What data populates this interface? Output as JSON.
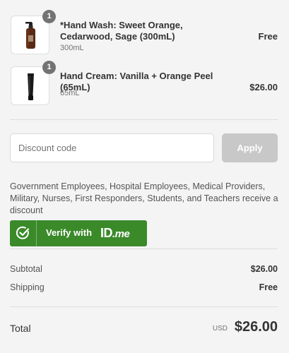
{
  "line_items": [
    {
      "name": "*Hand Wash: Sweet Orange, Cedarwood, Sage (300mL)",
      "variant": "300mL",
      "price": "Free",
      "quantity": "1",
      "image_icon": "amber-pump-bottle-icon"
    },
    {
      "name": "Hand Cream: Vanilla + Orange Peel (65mL)",
      "variant": "65mL",
      "price": "$26.00",
      "quantity": "1",
      "image_icon": "black-cream-tube-icon"
    }
  ],
  "discount": {
    "placeholder": "Discount code",
    "value": "",
    "apply_label": "Apply"
  },
  "idme": {
    "eligibility_text": "Government Employees, Hospital Employees, Medical Providers, Military, Nurses, First Responders, Students, and Teachers receive a discount",
    "verify_label": "Verify with",
    "logo_id": "ID",
    "logo_me": ".me",
    "button_color": "#3a8a2a"
  },
  "summary": {
    "subtotal_label": "Subtotal",
    "subtotal_value": "$26.00",
    "shipping_label": "Shipping",
    "shipping_value": "Free",
    "total_label": "Total",
    "total_currency": "USD",
    "total_value": "$26.00"
  }
}
